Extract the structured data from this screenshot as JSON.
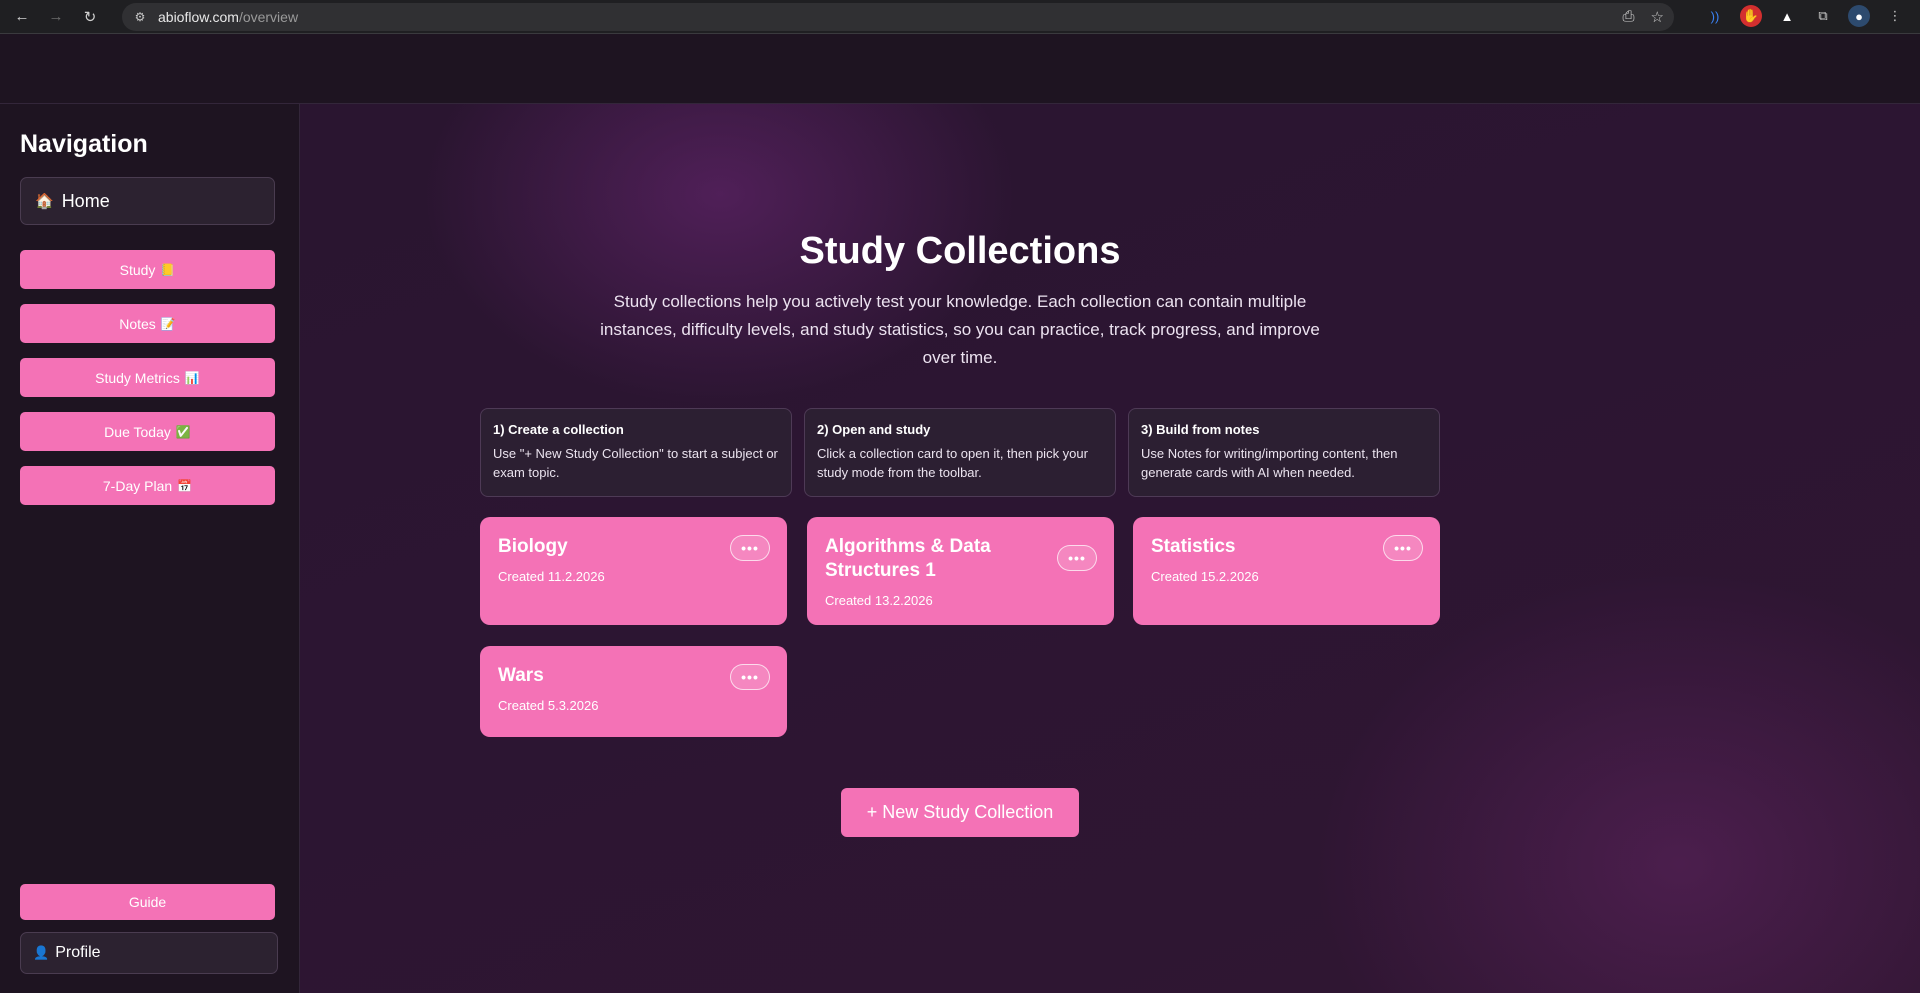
{
  "browser": {
    "url_host": "abioflow.com",
    "url_path": "/overview"
  },
  "sidebar": {
    "heading": "Navigation",
    "home": {
      "label": "Home",
      "icon": "🏠"
    },
    "items": [
      {
        "label": "Study",
        "icon": "📒"
      },
      {
        "label": "Notes",
        "icon": "📝"
      },
      {
        "label": "Study Metrics",
        "icon": "📊"
      },
      {
        "label": "Due Today",
        "icon": "✅"
      },
      {
        "label": "7-Day Plan",
        "icon": "📅"
      }
    ],
    "guide_label": "Guide",
    "profile": {
      "label": "Profile",
      "icon": "👤"
    }
  },
  "main": {
    "title": "Study Collections",
    "intro": "Study collections help you actively test your knowledge. Each collection can contain multiple instances, difficulty levels, and study statistics, so you can practice, track progress, and improve over time.",
    "steps": [
      {
        "title": "1) Create a collection",
        "desc": "Use \"+ New Study Collection\" to start a subject or exam topic."
      },
      {
        "title": "2) Open and study",
        "desc": "Click a collection card to open it, then pick your study mode from the toolbar."
      },
      {
        "title": "3) Build from notes",
        "desc": "Use Notes for writing/importing content, then generate cards with AI when needed."
      }
    ],
    "collections": [
      {
        "title": "Biology",
        "created": "Created 11.2.2026"
      },
      {
        "title": "Algorithms & Data Structures 1",
        "created": "Created 13.2.2026"
      },
      {
        "title": "Statistics",
        "created": "Created 15.2.2026"
      },
      {
        "title": "Wars",
        "created": "Created 5.3.2026"
      }
    ],
    "more_label": "•••",
    "new_button": "+ New Study Collection"
  },
  "colors": {
    "accent": "#f472b6",
    "sidebar_bg": "#1e1421",
    "panel_bg": "#2c1f32"
  }
}
